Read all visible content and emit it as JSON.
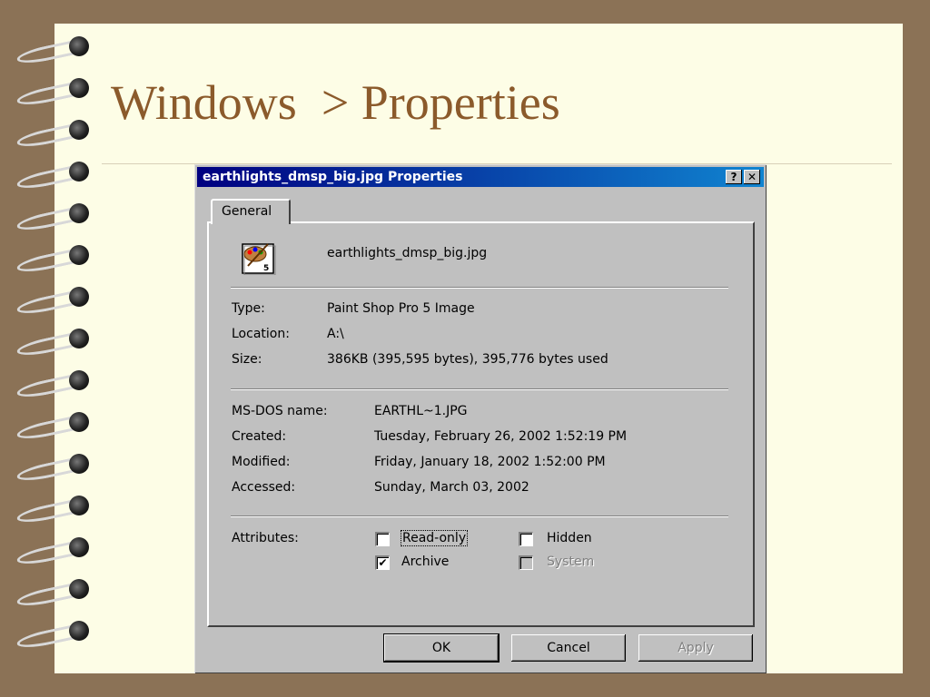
{
  "slide": {
    "title": "Windows  > Properties"
  },
  "dialog": {
    "title": "earthlights_dmsp_big.jpg Properties",
    "help_label": "?",
    "close_label": "✕",
    "tab_label": "General",
    "file_icon": "paint-shop-pro-icon",
    "file_name": "earthlights_dmsp_big.jpg",
    "type_label": "Type:",
    "type_value": "Paint Shop Pro 5 Image",
    "location_label": "Location:",
    "location_value": "A:\\",
    "size_label": "Size:",
    "size_value": "386KB (395,595 bytes), 395,776 bytes used",
    "msdos_label": "MS-DOS name:",
    "msdos_value": "EARTHL~1.JPG",
    "created_label": "Created:",
    "created_value": "Tuesday, February 26, 2002 1:52:19 PM",
    "modified_label": "Modified:",
    "modified_value": "Friday, January 18, 2002 1:52:00 PM",
    "accessed_label": "Accessed:",
    "accessed_value": "Sunday, March 03, 2002",
    "attributes_label": "Attributes:",
    "readonly": {
      "label": "Read-only",
      "checked": false,
      "enabled": true
    },
    "hidden": {
      "label": "Hidden",
      "checked": false,
      "enabled": true
    },
    "archive": {
      "label": "Archive",
      "checked": true,
      "enabled": true
    },
    "system": {
      "label": "System",
      "checked": false,
      "enabled": false
    },
    "ok_label": "OK",
    "cancel_label": "Cancel",
    "apply_label": "Apply",
    "check_glyph": "✔"
  },
  "colors": {
    "slide_bg": "#fdfde6",
    "frame": "#8b7256",
    "title_text": "#8b5a2b",
    "titlebar_start": "#000080",
    "titlebar_end": "#1084d0",
    "dialog_face": "#c0c0c0"
  }
}
